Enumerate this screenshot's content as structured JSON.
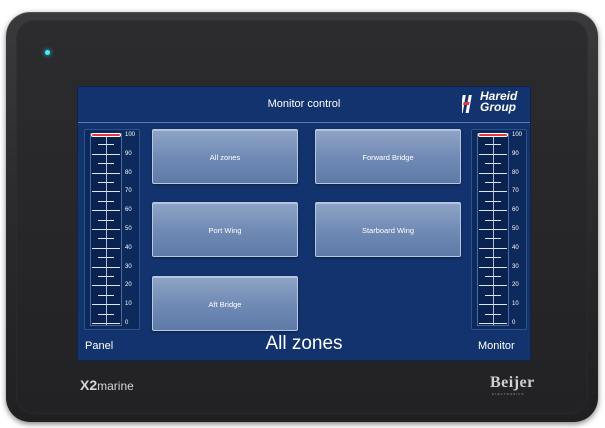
{
  "screen": {
    "title": "Monitor control",
    "logo": {
      "line1": "Hareid",
      "line2": "Group",
      "mark": "hareid-logo-icon"
    },
    "zone_status": "All zones",
    "panel_label": "Panel",
    "monitor_label": "Monitor"
  },
  "zones": [
    {
      "label": "All zones"
    },
    {
      "label": "Forward Bridge"
    },
    {
      "label": "Port Wing"
    },
    {
      "label": "Starboard Wing"
    },
    {
      "label": "Aft Bridge"
    }
  ],
  "scales": {
    "ticks": [
      "100",
      "90",
      "80",
      "70",
      "60",
      "50",
      "40",
      "30",
      "20",
      "10",
      "0"
    ],
    "panel_level": 100,
    "monitor_level": 100
  },
  "bezel": {
    "brand_left_bold": "X2",
    "brand_left_light": "marine",
    "brand_right": "Beijer",
    "brand_right_sub": "ELECTRONICS",
    "led_color": "#40f0ff"
  },
  "colors": {
    "screen_bg": "#12336d",
    "button_bg": "#7089b4",
    "indicator": "#e8343a"
  }
}
